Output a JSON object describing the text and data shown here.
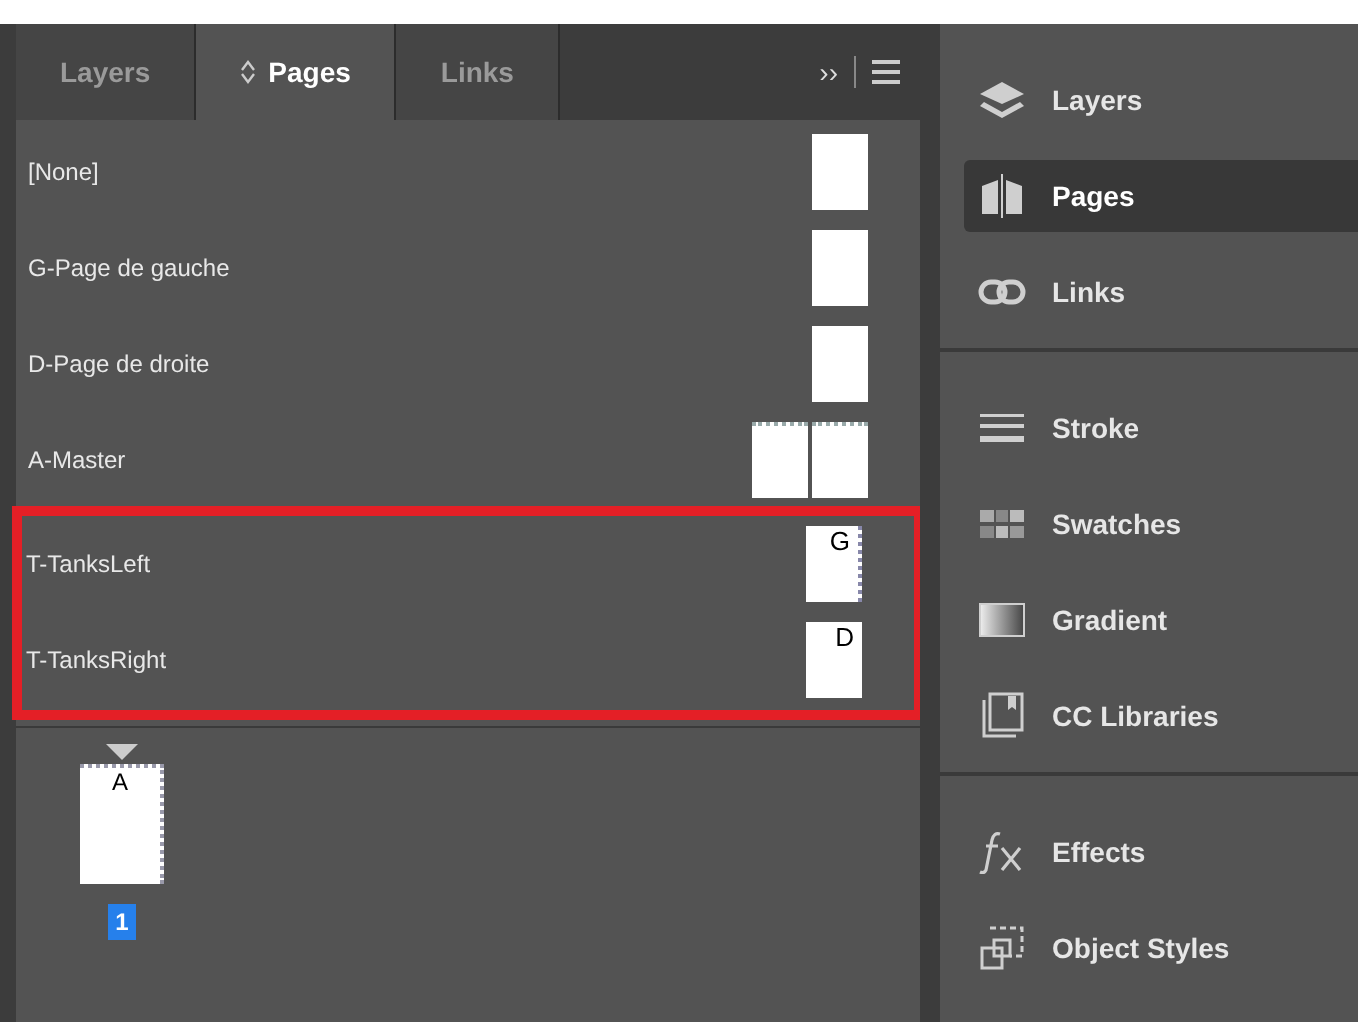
{
  "panel": {
    "tabs": [
      {
        "label": "Layers",
        "selected": false,
        "sort_icon": false
      },
      {
        "label": "Pages",
        "selected": true,
        "sort_icon": true
      },
      {
        "label": "Links",
        "selected": false,
        "sort_icon": false
      }
    ],
    "overflow_label": "››",
    "masters": [
      {
        "name": "[None]",
        "kind": "single",
        "highlighted": false
      },
      {
        "name": "G-Page de gauche",
        "kind": "single",
        "highlighted": false
      },
      {
        "name": "D-Page de droite",
        "kind": "single",
        "highlighted": false
      },
      {
        "name": "A-Master",
        "kind": "spread",
        "highlighted": false
      },
      {
        "name": "T-TanksLeft",
        "kind": "single",
        "letter": "G",
        "guides": true,
        "highlighted": true
      },
      {
        "name": "T-TanksRight",
        "kind": "single",
        "letter": "D",
        "guides": false,
        "highlighted": true
      }
    ],
    "pages": [
      {
        "master_letter": "A",
        "number": "1",
        "selected": true
      }
    ]
  },
  "dock": {
    "groups": [
      {
        "items": [
          {
            "kind": "layers",
            "label": "Layers",
            "selected": false
          },
          {
            "kind": "pages",
            "label": "Pages",
            "selected": true
          },
          {
            "kind": "links",
            "label": "Links",
            "selected": false
          }
        ]
      },
      {
        "items": [
          {
            "kind": "stroke",
            "label": "Stroke",
            "selected": false
          },
          {
            "kind": "swatches",
            "label": "Swatches",
            "selected": false
          },
          {
            "kind": "gradient",
            "label": "Gradient",
            "selected": false
          },
          {
            "kind": "libraries",
            "label": "CC Libraries",
            "selected": false
          }
        ]
      },
      {
        "items": [
          {
            "kind": "effects",
            "label": "Effects",
            "selected": false
          },
          {
            "kind": "styles",
            "label": "Object Styles",
            "selected": false
          }
        ]
      }
    ]
  }
}
